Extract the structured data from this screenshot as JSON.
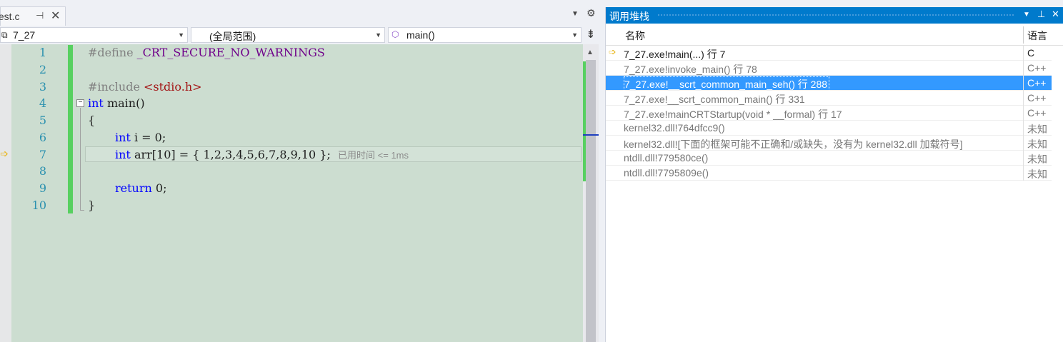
{
  "editor": {
    "tab": {
      "name": "test.c",
      "pin_icon": "pin-icon",
      "close": "✕"
    },
    "nav": {
      "project": "7_27",
      "scope": "(全局范围)",
      "function": "main()"
    },
    "line_numbers": [
      "1",
      "2",
      "3",
      "4",
      "5",
      "6",
      "7",
      "8",
      "9",
      "10"
    ],
    "code": {
      "l1_directive": "#define",
      "l1_macro": " _CRT_SECURE_NO_WARNINGS",
      "l3_directive": "#include",
      "l3_header": " <stdio.h>",
      "l4_kw": "int",
      "l4_rest": " main()",
      "l5": "{",
      "l6_kw": "int",
      "l6_rest": " i = 0;",
      "l7_kw": "int",
      "l7_rest": " arr[10] = { 1,2,3,4,5,6,7,8,9,10 };",
      "l7_perf": "已用时间 <= 1ms",
      "l9_kw": "return",
      "l9_rest": " 0;",
      "l10": "}"
    }
  },
  "callstack": {
    "title": "调用堆栈",
    "columns": {
      "name": "名称",
      "lang": "语言"
    },
    "rows": [
      {
        "name": "7_27.exe!main(...) 行 7",
        "lang": "C"
      },
      {
        "name": "7_27.exe!invoke_main() 行 78",
        "lang": "C++"
      },
      {
        "name": "7_27.exe!__scrt_common_main_seh() 行 288",
        "lang": "C++"
      },
      {
        "name": "7_27.exe!__scrt_common_main() 行 331",
        "lang": "C++"
      },
      {
        "name": "7_27.exe!mainCRTStartup(void * __formal) 行 17",
        "lang": "C++"
      },
      {
        "name": "kernel32.dll!764dfcc9()",
        "lang": "未知"
      },
      {
        "name": "kernel32.dll![下面的框架可能不正确和/或缺失，没有为 kernel32.dll 加载符号]",
        "lang": "未知"
      },
      {
        "name": "ntdll.dll!779580ce()",
        "lang": "未知"
      },
      {
        "name": "ntdll.dll!7795809e()",
        "lang": "未知"
      }
    ]
  },
  "colors": {
    "accent": "#007acc",
    "selection": "#3399ff",
    "code_bg": "#ccddd0",
    "change_bar": "#57d060",
    "exec_arrow": "#e8b61a"
  }
}
